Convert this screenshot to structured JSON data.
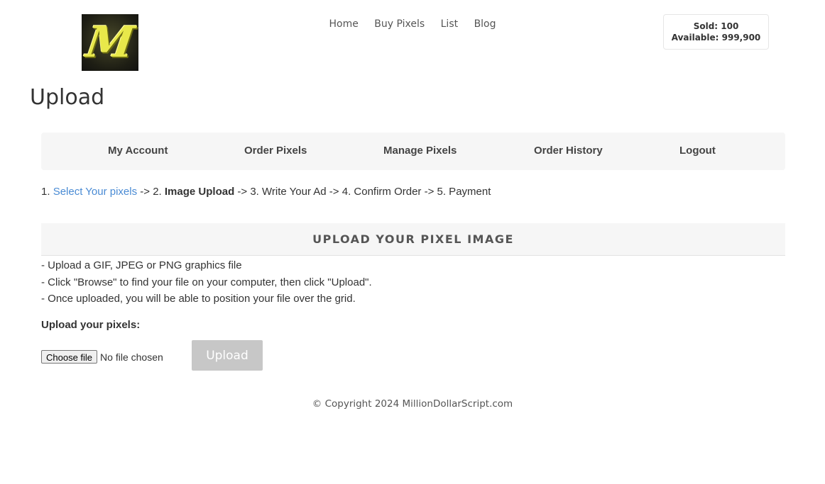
{
  "logo": {
    "letter": "M"
  },
  "nav": {
    "home": "Home",
    "buy": "Buy Pixels",
    "list": "List",
    "blog": "Blog"
  },
  "stats": {
    "sold": "Sold: 100",
    "available": "Available: 999,900"
  },
  "page_title": "Upload",
  "menu": {
    "my_account": "My Account",
    "order_pixels": "Order Pixels",
    "manage_pixels": "Manage Pixels",
    "order_history": "Order History",
    "logout": "Logout"
  },
  "steps": {
    "s1_prefix": "1. ",
    "s1_link": "Select Your pixels",
    "s2_prefix": " -> 2. ",
    "s2_current": "Image Upload",
    "rest": " -> 3. Write Your Ad -> 4. Confirm Order -> 5. Payment"
  },
  "panel": {
    "heading": "UPLOAD YOUR PIXEL IMAGE"
  },
  "instructions": [
    "- Upload a GIF, JPEG or PNG graphics file",
    "- Click \"Browse\" to find your file on your computer, then click \"Upload\".",
    "- Once uploaded, you will be able to position your file over the grid."
  ],
  "upload": {
    "label": "Upload your pixels:",
    "choose_file": "Choose file",
    "no_file": "No file chosen",
    "button": "Upload"
  },
  "footer": {
    "copyright": "© Copyright 2024 MillionDollarScript.com"
  }
}
